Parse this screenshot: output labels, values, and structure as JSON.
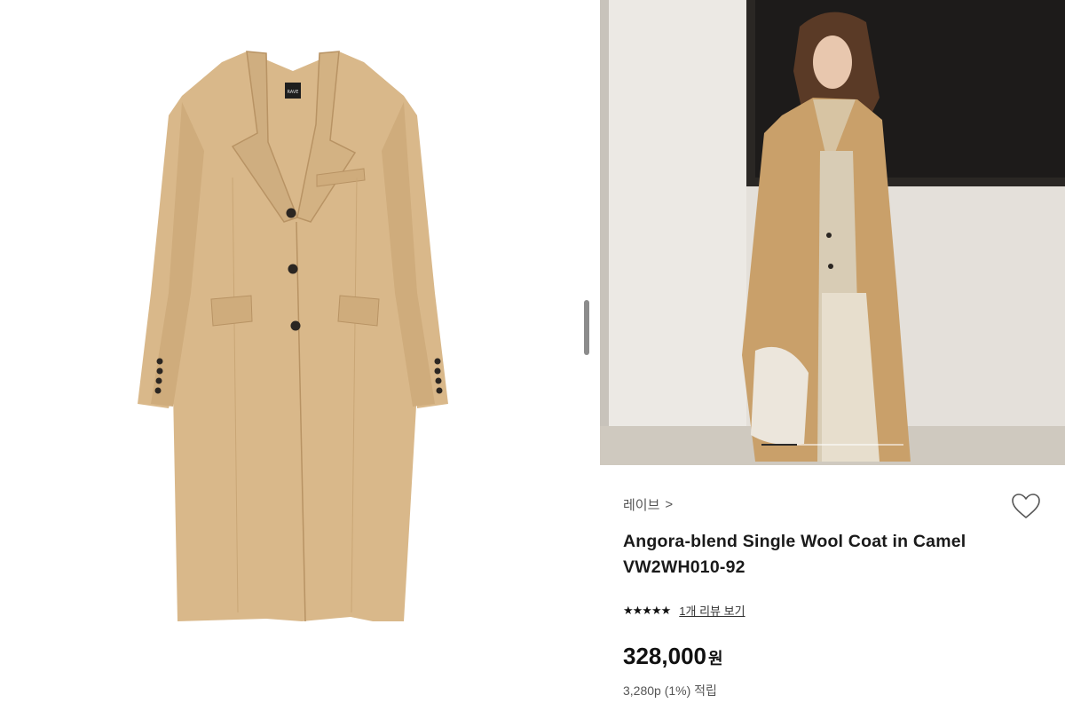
{
  "product": {
    "brand_label": "레이브",
    "brand_chevron": ">",
    "title": "Angora-blend Single Wool Coat in Camel VW2WH010-92",
    "rating_stars": "★★★★★",
    "review_link": "1개 리뷰 보기",
    "price_amount": "328,000",
    "price_unit": "원",
    "points_text": "3,280p (1%) 적립",
    "label_tag": "RAVE"
  },
  "carousel": {
    "active_index": 1,
    "total": 4
  },
  "colors": {
    "coat": "#D9B88A",
    "coat_shadow": "#C9A676",
    "button": "#2B2622",
    "text_dark": "#1A1A1A",
    "text_muted": "#555555"
  },
  "icons": {
    "heart": "heart-outline-icon",
    "chevron": "chevron-right-icon"
  }
}
